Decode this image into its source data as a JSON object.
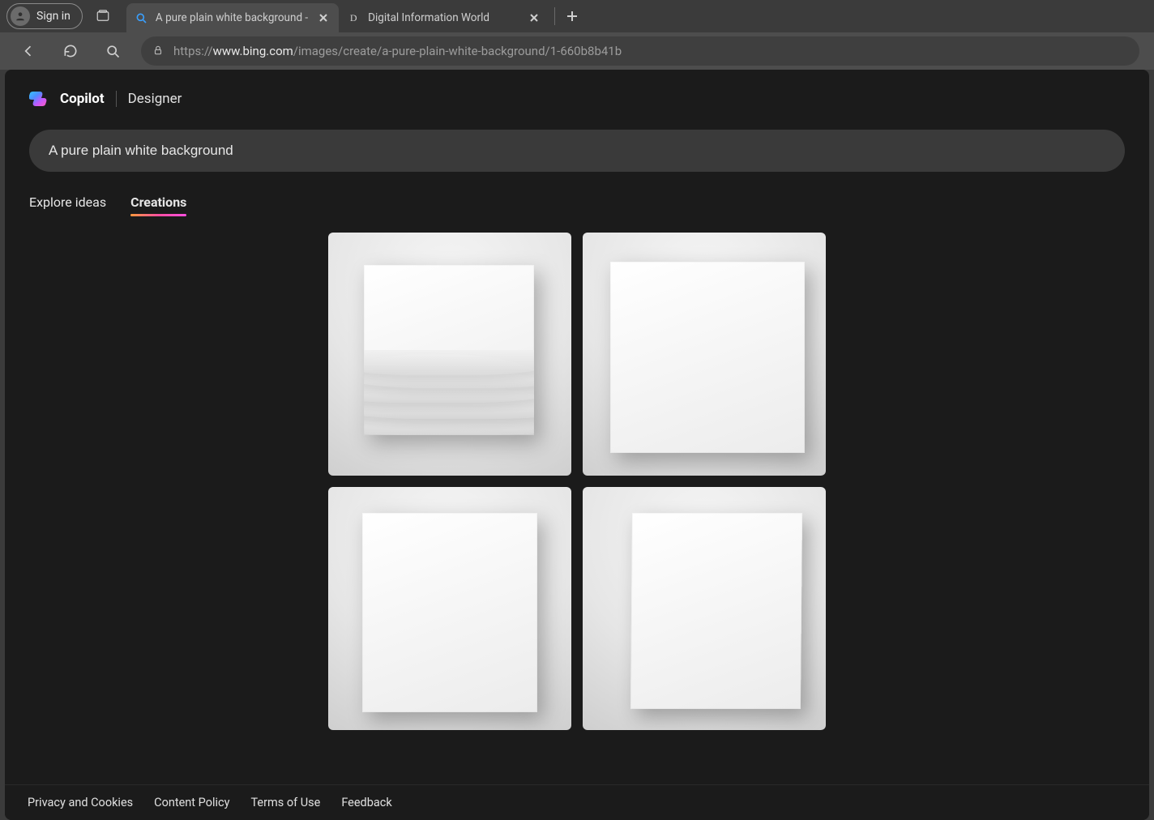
{
  "chrome": {
    "signin_label": "Sign in",
    "tabs": [
      {
        "title": "A pure plain white background - ",
        "active": true,
        "favicon": "bing-create"
      },
      {
        "title": "Digital Information World",
        "active": false,
        "favicon": "D"
      }
    ],
    "url_prefix": "https://",
    "url_domain": "www.bing.com",
    "url_path": "/images/create/a-pure-plain-white-background/1-660b8b41b"
  },
  "page": {
    "brand_primary": "Copilot",
    "brand_secondary": "Designer",
    "prompt_value": "A pure plain white background",
    "subtabs": [
      {
        "label": "Explore ideas",
        "active": false
      },
      {
        "label": "Creations",
        "active": true
      }
    ],
    "results": [
      {
        "variant": "white-canvas-wavy-relief"
      },
      {
        "variant": "white-canvas-plain-square"
      },
      {
        "variant": "white-canvas-plain-portrait"
      },
      {
        "variant": "white-canvas-leaning-wall"
      }
    ],
    "footer_links": [
      "Privacy and Cookies",
      "Content Policy",
      "Terms of Use",
      "Feedback"
    ]
  }
}
